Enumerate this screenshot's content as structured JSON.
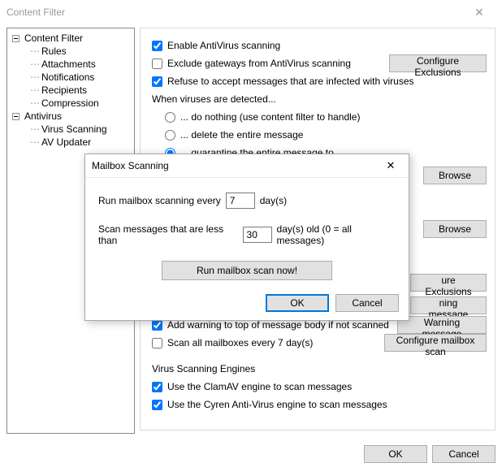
{
  "window": {
    "title": "Content Filter"
  },
  "tree": {
    "root": "Content Filter",
    "children": [
      "Rules",
      "Attachments",
      "Notifications",
      "Recipients",
      "Compression"
    ],
    "root2": "Antivirus",
    "children2": [
      "Virus Scanning",
      "AV Updater"
    ]
  },
  "main": {
    "enable_av": "Enable AntiVirus scanning",
    "exclude_gateways": "Exclude gateways from AntiVirus scanning",
    "configure_exclusions": "Configure Exclusions",
    "refuse_infected": "Refuse to accept messages that are infected with viruses",
    "detected_label": "When viruses are detected...",
    "opt_nothing": "... do nothing (use content filter to handle)",
    "opt_delete": "... delete the entire message",
    "opt_quarantine": "... quarantine the entire message to...",
    "browse": "Browse",
    "ure_exclusions": "ure Exclusions",
    "ning_message": "ning message",
    "add_warning": "Add warning to top of message body if not scanned",
    "warning_message": "Warning message",
    "scan_all": "Scan all mailboxes every 7 day(s)",
    "configure_mailbox_scan": "Configure mailbox scan",
    "engines_label": "Virus Scanning Engines",
    "use_clamav": "Use the ClamAV engine to scan messages",
    "use_cyren": "Use the Cyren Anti-Virus engine to scan messages"
  },
  "dialog": {
    "title": "Mailbox Scanning",
    "run_every_prefix": "Run mailbox scanning every",
    "run_every_value": "7",
    "run_every_suffix": "day(s)",
    "scan_less_prefix": "Scan messages that are less than",
    "scan_less_value": "30",
    "scan_less_suffix": "day(s) old (0 = all messages)",
    "run_now": "Run mailbox scan now!",
    "ok": "OK",
    "cancel": "Cancel"
  },
  "footer": {
    "ok": "OK",
    "cancel": "Cancel"
  }
}
